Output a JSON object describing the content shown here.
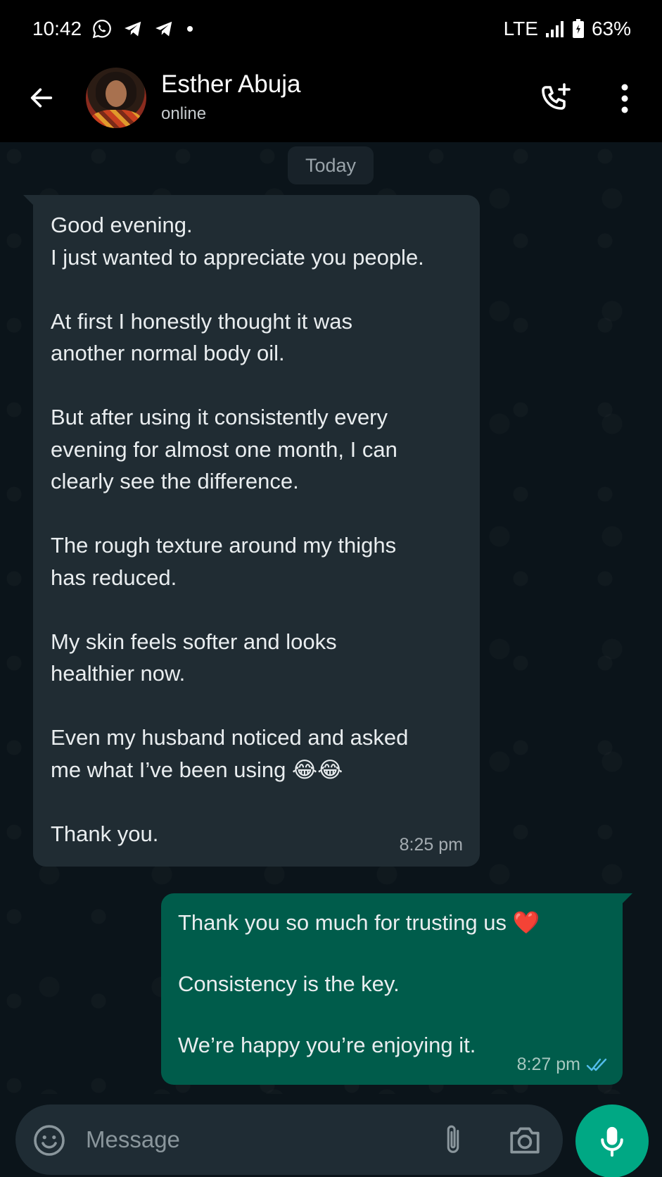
{
  "status_bar": {
    "time": "10:42",
    "network": "LTE",
    "battery": "63%",
    "notification_icons": [
      "whatsapp-icon",
      "telegram-icon",
      "telegram-icon",
      "dot-icon"
    ]
  },
  "header": {
    "contact_name": "Esther Abuja",
    "contact_status": "online",
    "icons": [
      "back-arrow-icon",
      "add-call-icon",
      "more-vert-icon"
    ]
  },
  "chat": {
    "date_chip": "Today",
    "messages": [
      {
        "direction": "incoming",
        "text": "Good evening.\nI just wanted to appreciate you people.\n\nAt first I honestly thought it was\nanother normal body oil.\n\nBut after using it consistently every\nevening for almost one month, I can\nclearly see the difference.\n\nThe rough texture around my thighs\nhas reduced.\n\nMy skin feels softer and looks\nhealthier now.\n\nEven my husband noticed and asked\nme what I’ve been using 😂😂\n\nThank you.",
        "time": "8:25 pm"
      },
      {
        "direction": "outgoing",
        "text": "Thank you so much for trusting us ❤️\n\nConsistency is the key.\n\nWe’re happy you’re enjoying it.",
        "time": "8:27 pm",
        "read": true
      }
    ]
  },
  "input_bar": {
    "placeholder": "Message",
    "icons": [
      "emoji-icon",
      "attach-icon",
      "camera-icon",
      "mic-icon"
    ]
  },
  "colors": {
    "background": "#0b141a",
    "incoming_bubble": "#202c33",
    "outgoing_bubble": "#005c4b",
    "accent": "#00a884",
    "read_ticks": "#53bdeb"
  }
}
